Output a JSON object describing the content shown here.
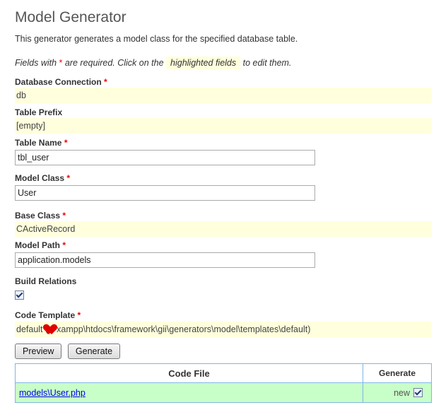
{
  "page": {
    "title": "Model Generator",
    "description": "This generator generates a model class for the specified database table.",
    "note_prefix": "Fields with ",
    "note_star": "*",
    "note_mid": " are required. Click on the ",
    "note_highlight": "highlighted fields",
    "note_suffix": " to edit them."
  },
  "required_mark": "*",
  "fields": {
    "db_connection": {
      "label": "Database Connection",
      "value": "db"
    },
    "table_prefix": {
      "label": "Table Prefix",
      "value": "[empty]"
    },
    "table_name": {
      "label": "Table Name",
      "value": "tbl_user"
    },
    "model_class": {
      "label": "Model Class",
      "value": "User"
    },
    "base_class": {
      "label": "Base Class",
      "value": "CActiveRecord"
    },
    "model_path": {
      "label": "Model Path",
      "value": "application.models"
    },
    "build_relations": {
      "label": "Build Relations",
      "checked": true
    },
    "code_template": {
      "label": "Code Template",
      "value_prefix": "default (",
      "value_rest": "xampp\\htdocs\\framework\\gii\\generators\\model\\templates\\default)"
    }
  },
  "buttons": {
    "preview": "Preview",
    "generate": "Generate"
  },
  "table": {
    "headers": {
      "code_file": "Code File",
      "generate": "Generate"
    },
    "rows": [
      {
        "file": "models\\User.php",
        "status": "new",
        "checked": true
      }
    ]
  },
  "colors": {
    "sticky": "#ffffdd",
    "row_new": "#c8ffc8",
    "border": "#7fb6e5",
    "required": "#ee0000"
  }
}
